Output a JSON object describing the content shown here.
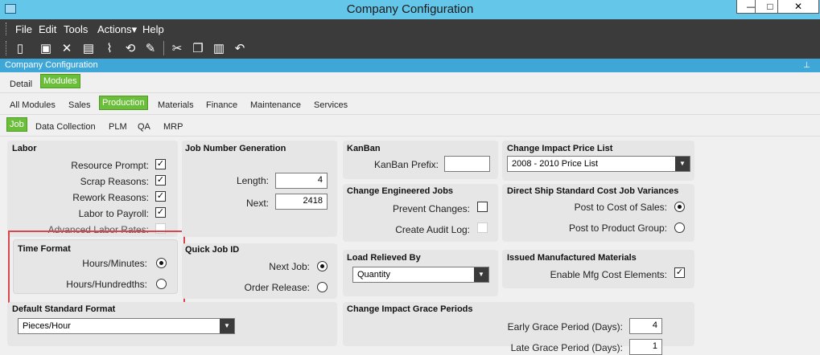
{
  "window": {
    "title": "Company Configuration",
    "min_glyph": "—",
    "max_glyph": "□",
    "close_glyph": "✕"
  },
  "menu": [
    "File",
    "Edit",
    "Tools",
    "Actions▾",
    "Help"
  ],
  "toolbar_icons": [
    "new-icon",
    "save-icon",
    "delete-icon",
    "book-icon",
    "attach-icon",
    "refresh-icon",
    "clear-icon",
    "cut-icon",
    "copy-icon",
    "paste-icon",
    "undo-icon"
  ],
  "panel_header": {
    "title": "Company Configuration",
    "pin_glyph": "⊥"
  },
  "tabs_level1": [
    "Detail",
    "Modules"
  ],
  "tabs_level2": [
    "All Modules",
    "Sales",
    "Production",
    "Materials",
    "Finance",
    "Maintenance",
    "Services"
  ],
  "tabs_level3": [
    "Job",
    "Data Collection",
    "PLM",
    "QA",
    "MRP"
  ],
  "labor": {
    "title": "Labor",
    "resource_prompt": "Resource Prompt:",
    "scrap_reasons": "Scrap Reasons:",
    "rework_reasons": "Rework Reasons:",
    "labor_to_payroll": "Labor to Payroll:",
    "advanced_labor_rates": "Advanced Labor Rates:",
    "check_glyph": "✓"
  },
  "time_format": {
    "title": "Time Format",
    "hours_minutes": "Hours/Minutes:",
    "hours_hundredths": "Hours/Hundredths:"
  },
  "default_standard_format": {
    "title": "Default Standard Format",
    "value": "Pieces/Hour"
  },
  "job_number_generation": {
    "title": "Job Number Generation",
    "length_label": "Length:",
    "length_value": "4",
    "next_label": "Next:",
    "next_value": "2418"
  },
  "quick_job_id": {
    "title": "Quick Job ID",
    "next_job": "Next Job:",
    "order_release": "Order Release:"
  },
  "kanban": {
    "title": "KanBan",
    "prefix_label": "KanBan Prefix:",
    "prefix_value": ""
  },
  "change_engineered_jobs": {
    "title": "Change Engineered Jobs",
    "prevent_changes": "Prevent Changes:",
    "create_audit_log": "Create Audit Log:"
  },
  "load_relieved_by": {
    "title": "Load Relieved By",
    "value": "Quantity"
  },
  "change_impact_grace": {
    "title": "Change Impact Grace Periods",
    "early_label": "Early Grace Period (Days):",
    "early_value": "4",
    "late_label": "Late Grace Period (Days):",
    "late_value": "1"
  },
  "change_impact_price_list": {
    "title": "Change Impact Price List",
    "value": "2008 - 2010 Price List"
  },
  "direct_ship": {
    "title": "Direct Ship Standard Cost Job Variances",
    "post_cost_sales": "Post to Cost of Sales:",
    "post_product_group": "Post to Product Group:"
  },
  "issued_materials": {
    "title": "Issued Manufactured Materials",
    "enable_mfg": "Enable Mfg Cost Elements:"
  },
  "arrow_glyph": "▼"
}
